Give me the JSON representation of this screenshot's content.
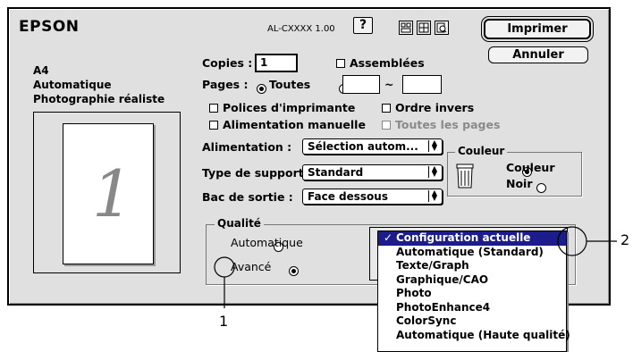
{
  "brand": "EPSON",
  "model": "AL-CXXXX 1.00",
  "buttons": {
    "help": "?",
    "print": "Imprimer",
    "cancel": "Annuler"
  },
  "summary": {
    "line1": "A4",
    "line2": "Automatique",
    "line3": "Photographie réaliste",
    "preview_number": "1"
  },
  "copies": {
    "label": "Copies :",
    "value": "1",
    "collate_label": "Assemblées"
  },
  "pages": {
    "label": "Pages :",
    "all_label": "Toutes",
    "range_sep": "~",
    "from": "",
    "to": ""
  },
  "options": {
    "printer_fonts": "Polices d'imprimante",
    "reverse_order": "Ordre invers",
    "manual_feed": "Alimentation manuelle",
    "all_pages": "Toutes les pages"
  },
  "paper_source": {
    "label": "Alimentation :",
    "value": "Sélection autom..."
  },
  "media_type": {
    "label": "Type de support :",
    "value": "Standard"
  },
  "output_tray": {
    "label": "Bac de sortie :",
    "value": "Face dessous"
  },
  "color": {
    "title": "Couleur",
    "color_label": "Couleur",
    "bw_label": "Noir"
  },
  "quality": {
    "title": "Qualité",
    "auto_label": "Automatique",
    "advanced_label": "Avancé"
  },
  "menu": {
    "selected": "Configuration actuelle",
    "items": [
      "Automatique (Standard)",
      "Texte/Graph",
      "Graphique/CAO",
      "Photo",
      "PhotoEnhance4",
      "ColorSync",
      "Automatique (Haute qualité)"
    ]
  },
  "callouts": {
    "one": "1",
    "two": "2"
  },
  "colors": {
    "selection": "#1c1c8c",
    "dialog_bg": "#e0e0e0"
  }
}
